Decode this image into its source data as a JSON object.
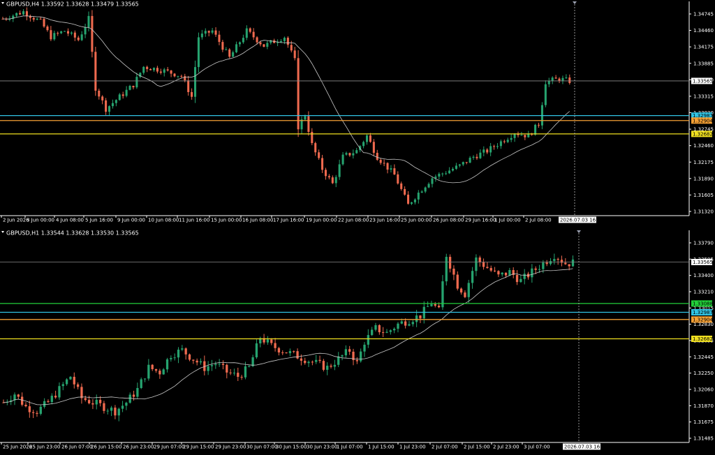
{
  "colors": {
    "background": "#000000",
    "bull": "#26a36f",
    "bear": "#ef6a4f",
    "ma": "#c8c8c8",
    "bid_line": "#8a8a8a",
    "cyan": "#31c4e4",
    "orange": "#f5a034",
    "yellow": "#f0e020",
    "green": "#22d03a",
    "frame": "#ffffff"
  },
  "chart_data": [
    {
      "type": "candlestick",
      "header": "GBPUSD,H4  1.33592 1.33628 1.33479 1.33565",
      "ylim": [
        1.3132,
        1.3489
      ],
      "yticks": [
        "1.34745",
        "1.34460",
        "1.34175",
        "1.33885",
        "1.33600",
        "1.33315",
        "1.33030",
        "1.32745",
        "1.32460",
        "1.32175",
        "1.31890",
        "1.31605",
        "1.31320"
      ],
      "xticks": [
        "2 Jun 2026",
        "3 Jun 00:00",
        "4 Jun 08:00",
        "5 Jun 16:00",
        "9 Jun 00:00",
        "10 Jun 08:00",
        "11 Jun 16:00",
        "15 Jun 00:00",
        "16 Jun 08:00",
        "17 Jun 16:00",
        "19 Jun 00:00",
        "22 Jun 08:00",
        "23 Jun 16:00",
        "25 Jun 00:00",
        "26 Jun 08:00",
        "29 Jun 16:00",
        "1 Jul 00:00",
        "2 Jul 08:00"
      ],
      "cursor_time": "2026.07.03 16:00",
      "price_tag": "1.33565",
      "levels": [
        {
          "price": 1.33565,
          "label": "1.33565",
          "color": "#8a8a8a"
        },
        {
          "price": 1.32987,
          "label": "1.32987",
          "color": "#31c4e4"
        },
        {
          "price": 1.32904,
          "label": "1.32904",
          "color": "#f5a034"
        },
        {
          "price": 1.32682,
          "label": "1.32682",
          "color": "#f0e020"
        }
      ],
      "waypoints": [
        [
          0,
          1.346
        ],
        [
          6,
          1.3472
        ],
        [
          11,
          1.3455
        ],
        [
          14,
          1.343
        ],
        [
          18,
          1.344
        ],
        [
          22,
          1.3425
        ],
        [
          25,
          1.346
        ],
        [
          27,
          1.3345
        ],
        [
          30,
          1.331
        ],
        [
          34,
          1.333
        ],
        [
          38,
          1.335
        ],
        [
          41,
          1.338
        ],
        [
          46,
          1.3375
        ],
        [
          52,
          1.3365
        ],
        [
          55,
          1.333
        ],
        [
          57,
          1.343
        ],
        [
          61,
          1.344
        ],
        [
          66,
          1.3395
        ],
        [
          71,
          1.344
        ],
        [
          76,
          1.3415
        ],
        [
          82,
          1.343
        ],
        [
          85,
          1.339
        ],
        [
          86,
          1.328
        ],
        [
          88,
          1.33
        ],
        [
          90,
          1.325
        ],
        [
          93,
          1.321
        ],
        [
          96,
          1.3185
        ],
        [
          99,
          1.323
        ],
        [
          103,
          1.324
        ],
        [
          106,
          1.3265
        ],
        [
          109,
          1.323
        ],
        [
          114,
          1.32
        ],
        [
          118,
          1.315
        ],
        [
          121,
          1.317
        ],
        [
          125,
          1.3195
        ],
        [
          129,
          1.3205
        ],
        [
          133,
          1.3215
        ],
        [
          137,
          1.323
        ],
        [
          141,
          1.324
        ],
        [
          145,
          1.3255
        ],
        [
          149,
          1.327
        ],
        [
          153,
          1.3265
        ],
        [
          156,
          1.3285
        ],
        [
          158,
          1.3355
        ],
        [
          162,
          1.336
        ],
        [
          166,
          1.3355
        ],
        [
          167,
          1.3356
        ]
      ]
    },
    {
      "type": "candlestick",
      "header": "GBPUSD,H1  1.33544 1.33628 1.33530 1.33565",
      "ylim": [
        1.3149,
        1.3393
      ],
      "yticks": [
        "1.33790",
        "1.33595",
        "1.33400",
        "1.33210",
        "1.33015",
        "1.32830",
        "1.32635",
        "1.32445",
        "1.32250",
        "1.32060",
        "1.31870",
        "1.31675",
        "1.31485"
      ],
      "xticks": [
        "25 Jun 2026",
        "25 Jun 23:00",
        "26 Jun 07:00",
        "26 Jun 15:00",
        "26 Jun 23:00",
        "29 Jun 07:00",
        "29 Jun 15:00",
        "29 Jun 23:00",
        "30 Jun 07:00",
        "30 Jun 15:00",
        "30 Jun 23:00",
        "1 Jul 07:00",
        "1 Jul 15:00",
        "1 Jul 23:00",
        "2 Jul 07:00",
        "2 Jul 15:00",
        "2 Jul 23:00",
        "3 Jul 07:00"
      ],
      "cursor_time": "2026.07.03 16:00",
      "price_tag": "1.33565",
      "levels": [
        {
          "price": 1.33565,
          "label": "1.33565",
          "color": "#8a8a8a"
        },
        {
          "price": 1.33088,
          "label": "1.33088",
          "color": "#22d03a"
        },
        {
          "price": 1.32987,
          "label": "1.32987",
          "color": "#31c4e4"
        },
        {
          "price": 1.32904,
          "label": "1.32904",
          "color": "#f5a034"
        },
        {
          "price": 1.32682,
          "label": "1.32682",
          "color": "#f0e020"
        }
      ],
      "waypoints": [
        [
          0,
          1.3195
        ],
        [
          3,
          1.3205
        ],
        [
          6,
          1.319
        ],
        [
          9,
          1.3185
        ],
        [
          12,
          1.3195
        ],
        [
          15,
          1.321
        ],
        [
          18,
          1.3225
        ],
        [
          21,
          1.32
        ],
        [
          24,
          1.3195
        ],
        [
          27,
          1.319
        ],
        [
          30,
          1.3185
        ],
        [
          33,
          1.3195
        ],
        [
          36,
          1.321
        ],
        [
          39,
          1.3235
        ],
        [
          42,
          1.323
        ],
        [
          45,
          1.325
        ],
        [
          48,
          1.3255
        ],
        [
          51,
          1.3245
        ],
        [
          54,
          1.3235
        ],
        [
          57,
          1.324
        ],
        [
          60,
          1.323
        ],
        [
          63,
          1.3225
        ],
        [
          66,
          1.3235
        ],
        [
          69,
          1.327
        ],
        [
          72,
          1.326
        ],
        [
          75,
          1.3255
        ],
        [
          78,
          1.325
        ],
        [
          81,
          1.3245
        ],
        [
          84,
          1.324
        ],
        [
          87,
          1.3235
        ],
        [
          90,
          1.3245
        ],
        [
          93,
          1.3255
        ],
        [
          95,
          1.324
        ],
        [
          97,
          1.3265
        ],
        [
          100,
          1.328
        ],
        [
          103,
          1.3275
        ],
        [
          106,
          1.3285
        ],
        [
          109,
          1.329
        ],
        [
          112,
          1.3295
        ],
        [
          115,
          1.331
        ],
        [
          117,
          1.33
        ],
        [
          119,
          1.3365
        ],
        [
          122,
          1.333
        ],
        [
          124,
          1.332
        ],
        [
          127,
          1.336
        ],
        [
          130,
          1.335
        ],
        [
          133,
          1.334
        ],
        [
          136,
          1.3345
        ],
        [
          139,
          1.3335
        ],
        [
          142,
          1.3345
        ],
        [
          145,
          1.3355
        ],
        [
          148,
          1.3365
        ],
        [
          151,
          1.3355
        ],
        [
          154,
          1.3356
        ]
      ]
    }
  ]
}
